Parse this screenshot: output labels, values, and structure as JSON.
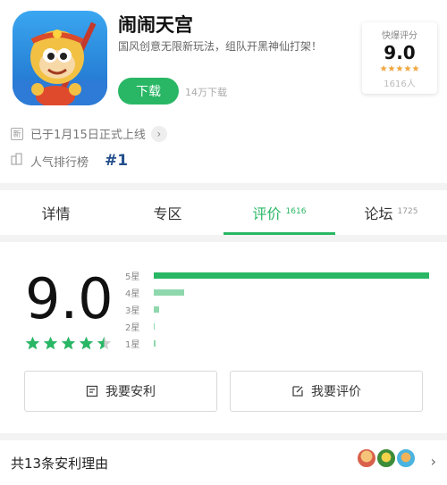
{
  "app": {
    "title": "闹闹天宫",
    "slogan": "国风创意无限新玩法，组队开黑神仙打架！",
    "download_label": "下载",
    "download_count": "14万下载",
    "launch_text": "已于1月15日正式上线",
    "launch_badge": "新",
    "rank_label": "人气排行榜",
    "rank_value": "#1"
  },
  "score_card": {
    "label": "快爆评分",
    "score": "9.0",
    "stars": "★★★★★",
    "count": "1616人"
  },
  "tabs": [
    {
      "label": "详情",
      "count": ""
    },
    {
      "label": "专区",
      "count": ""
    },
    {
      "label": "评价",
      "count": "1616"
    },
    {
      "label": "论坛",
      "count": "1725"
    }
  ],
  "active_tab": "评价",
  "rating": {
    "score": "9.0",
    "star_fill": 4.5,
    "distribution": [
      {
        "label": "5星",
        "fraction": 1.0
      },
      {
        "label": "4星",
        "fraction": 0.11
      },
      {
        "label": "3星",
        "fraction": 0.02
      },
      {
        "label": "2星",
        "fraction": 0.0
      },
      {
        "label": "1星",
        "fraction": 0.006
      }
    ]
  },
  "actions": {
    "recommend": "我要安利",
    "review": "我要评价"
  },
  "reasons": {
    "text": "共13条安利理由"
  },
  "colors": {
    "accent": "#29b765",
    "star_gold": "#f1a43c",
    "rank_blue": "#234f8c"
  }
}
